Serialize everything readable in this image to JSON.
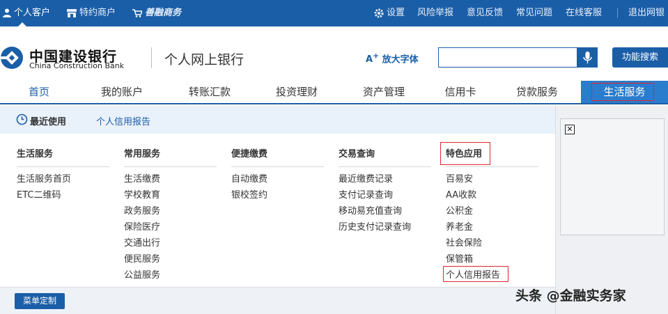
{
  "topbar": {
    "personal": "个人客户",
    "merchant": "特约商户",
    "shanrong": "善融商务",
    "settings": "设置",
    "risk_report": "风险举报",
    "feedback": "意见反馈",
    "faq": "常见问题",
    "online_service": "在线客服",
    "logout": "退出网银"
  },
  "header": {
    "bank_name_cn": "中国建设银行",
    "bank_name_en": "China Construction Bank",
    "site_title": "个人网上银行",
    "font_enlarge": "放大字体",
    "search_placeholder": "",
    "func_search": "功能搜索"
  },
  "nav": {
    "items": [
      "首页",
      "我的账户",
      "转账汇款",
      "投资理财",
      "资产管理",
      "信用卡",
      "贷款服务",
      "生活服务"
    ]
  },
  "recent": {
    "label": "最近使用",
    "link": "个人信用报告"
  },
  "columns": [
    {
      "title": "生活服务",
      "items": [
        "生活服务首页",
        "ETC二维码"
      ]
    },
    {
      "title": "常用服务",
      "items": [
        "生活缴费",
        "学校教育",
        "政务服务",
        "保险医疗",
        "交通出行",
        "便民服务",
        "公益服务"
      ]
    },
    {
      "title": "便捷缴费",
      "items": [
        "自动缴费",
        "银校签约"
      ]
    },
    {
      "title": "交易查询",
      "items": [
        "最近缴费记录",
        "支付记录查询",
        "移动易充值查询",
        "历史支付记录查询"
      ]
    },
    {
      "title": "特色应用",
      "items": [
        "百易安",
        "AA收款",
        "公积金",
        "养老金",
        "社会保险",
        "保管箱",
        "个人信用报告"
      ]
    }
  ],
  "footer": {
    "menu_custom": "菜单定制"
  },
  "watermark": "头条 @金融实务家",
  "colors": {
    "brand_blue": "#1b5ea8",
    "highlight_red": "#e0262c"
  }
}
